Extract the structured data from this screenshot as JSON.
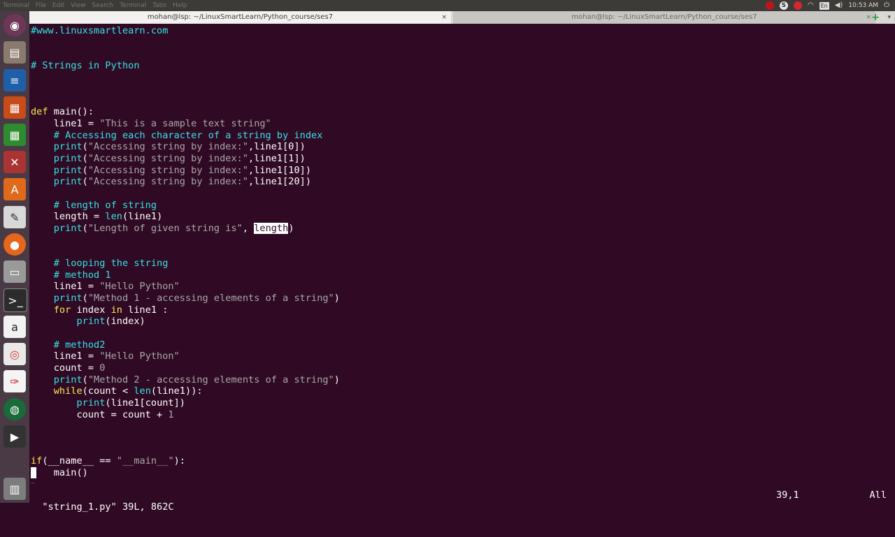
{
  "topbar": {
    "menus": [
      "Terminal",
      "File",
      "Edit",
      "View",
      "Search",
      "Terminal",
      "Tabs",
      "Help"
    ],
    "language": "En",
    "clock": "10:53 AM"
  },
  "launcher": {
    "icons": [
      "ubuntu-icon",
      "files-icon",
      "writer-icon",
      "impress-icon",
      "calc-icon",
      "settings-icon",
      "software-icon",
      "editor-icon",
      "firefox-icon",
      "drive-icon",
      "terminal-icon",
      "amazon-icon",
      "chrome-icon",
      "scribble-icon",
      "globe-icon",
      "video-icon",
      "trash-icon"
    ]
  },
  "tabs": {
    "active": "mohan@lsp: ~/LinuxSmartLearn/Python_course/ses7",
    "inactive": "mohan@lsp: ~/LinuxSmartLearn/Python_course/ses7",
    "close": "×"
  },
  "code": {
    "l1": "#www.linuxsmartlearn.com",
    "l2": "# Strings in Python",
    "def": "def",
    "main_sig": " main():",
    "line1_assign": "    line1 = ",
    "sample_str": "\"This is a sample text string\"",
    "comment_access": "    # Accessing each character of a string by index",
    "p_kw": "print",
    "p_open": "(",
    "acc_str": "\"Accessing string by index:\"",
    "idx0": ",line1[0])",
    "idx1": ",line1[1])",
    "idx10": ",line1[10])",
    "idx20": ",line1[20])",
    "comment_len": "    # length of string",
    "len_assign": "    length = ",
    "len_fn": "len",
    "len_arg": "(line1)",
    "len_str": "\"Length of given string is\"",
    "len_sep": ", ",
    "len_var": "length",
    "len_close": ")",
    "comment_loop": "    # looping the string",
    "comment_m1": "    # method 1",
    "hello_str": "\"Hello Python\"",
    "m1_str": "\"Method 1 - accessing elements of a string\"",
    "for_kw": "for",
    "for_mid": " index ",
    "in_kw": "in",
    "for_end": " line1 :",
    "print_index": "(index)",
    "comment_m2": "    # method2",
    "count_assign": "    count = ",
    "zero": "0",
    "m2_str": "\"Method 2 - accessing elements of a string\"",
    "while_kw": "while",
    "while_mid": "(count < ",
    "while_end": "(line1)):",
    "print_count": "(line1[count])",
    "count_inc": "        count = count + ",
    "one": "1",
    "if_kw": "if",
    "if_mid": "(__name__ == ",
    "main_str": "\"__main__\"",
    "if_end": "):",
    "main_call": "   main()",
    "tilde": "~"
  },
  "status": {
    "file": "\"string_1.py\" 39L, 862C",
    "position": "39,1",
    "scroll": "All"
  }
}
